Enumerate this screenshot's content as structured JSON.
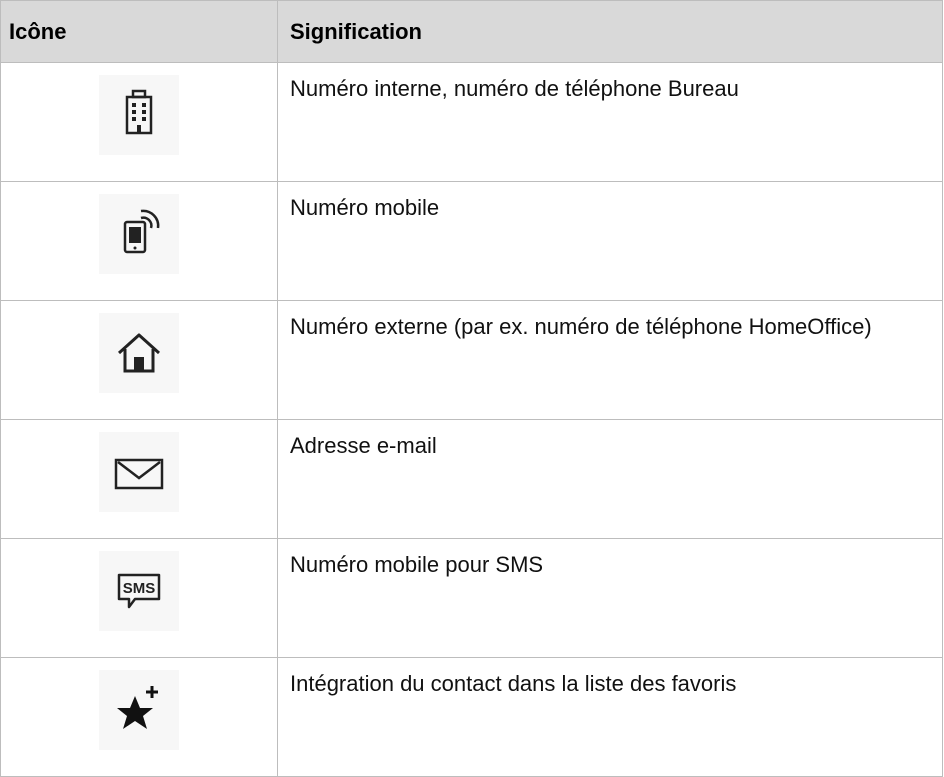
{
  "table": {
    "headers": {
      "icon": "Icône",
      "meaning": "Signification"
    },
    "rows": [
      {
        "icon": "office-building-icon",
        "meaning": "Numéro interne, numéro de téléphone Bureau"
      },
      {
        "icon": "mobile-phone-icon",
        "meaning": "Numéro mobile"
      },
      {
        "icon": "home-icon",
        "meaning": "Numéro externe (par ex. numéro de téléphone HomeOffice)"
      },
      {
        "icon": "envelope-icon",
        "meaning": "Adresse e-mail"
      },
      {
        "icon": "sms-icon",
        "meaning": "Numéro mobile pour SMS",
        "icon_text": "SMS"
      },
      {
        "icon": "star-plus-icon",
        "meaning": "Intégration du contact dans la liste des favoris"
      }
    ]
  }
}
